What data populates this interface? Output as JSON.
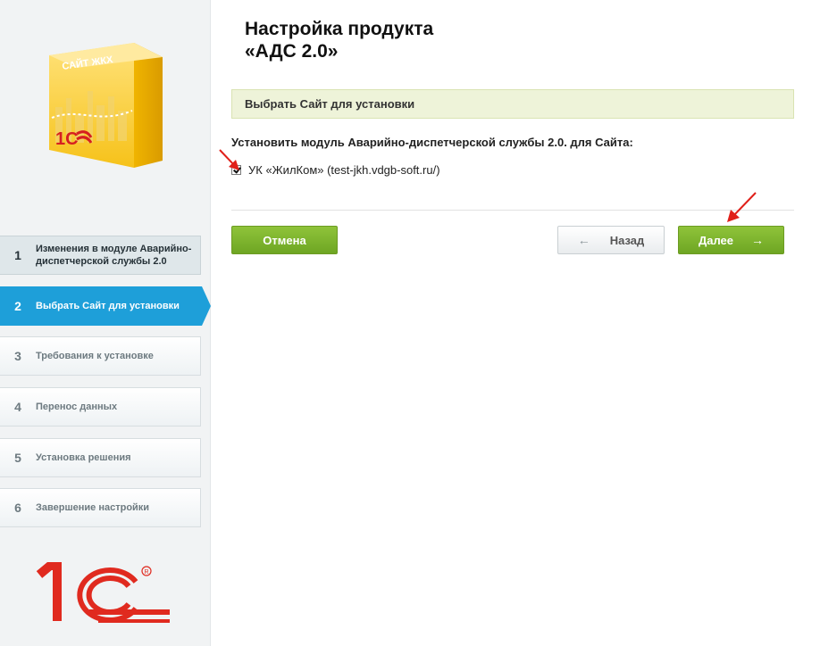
{
  "product": {
    "box_label": "САЙТ ЖКХ",
    "box_brand": "1С"
  },
  "sidebar": {
    "steps": [
      {
        "number": "1",
        "label": "Изменения в модуле Аварийно-диспетчерской службы 2.0",
        "state": "done"
      },
      {
        "number": "2",
        "label": "Выбрать Сайт для установки",
        "state": "active"
      },
      {
        "number": "3",
        "label": "Требования к установке",
        "state": "pending"
      },
      {
        "number": "4",
        "label": "Перенос данных",
        "state": "pending"
      },
      {
        "number": "5",
        "label": "Установка решения",
        "state": "pending"
      },
      {
        "number": "6",
        "label": "Завершение настройки",
        "state": "pending"
      }
    ]
  },
  "main": {
    "title_line1": "Настройка продукта",
    "title_line2": "«АДС 2.0»",
    "section_title": "Выбрать Сайт для установки",
    "module_label": "Установить модуль Аварийно-диспетчерской службы 2.0. для Сайта:",
    "site_option": {
      "label": "УК «ЖилКом» (test-jkh.vdgb-soft.ru/)",
      "checked": true
    }
  },
  "buttons": {
    "cancel": "Отмена",
    "back": "Назад",
    "next": "Далее",
    "back_arrow": "←",
    "next_arrow": "→"
  },
  "colors": {
    "accent_blue": "#1e9fd9",
    "button_green": "#7db32c",
    "section_bg": "#eef3d9",
    "annotation_red": "#e0201a"
  }
}
